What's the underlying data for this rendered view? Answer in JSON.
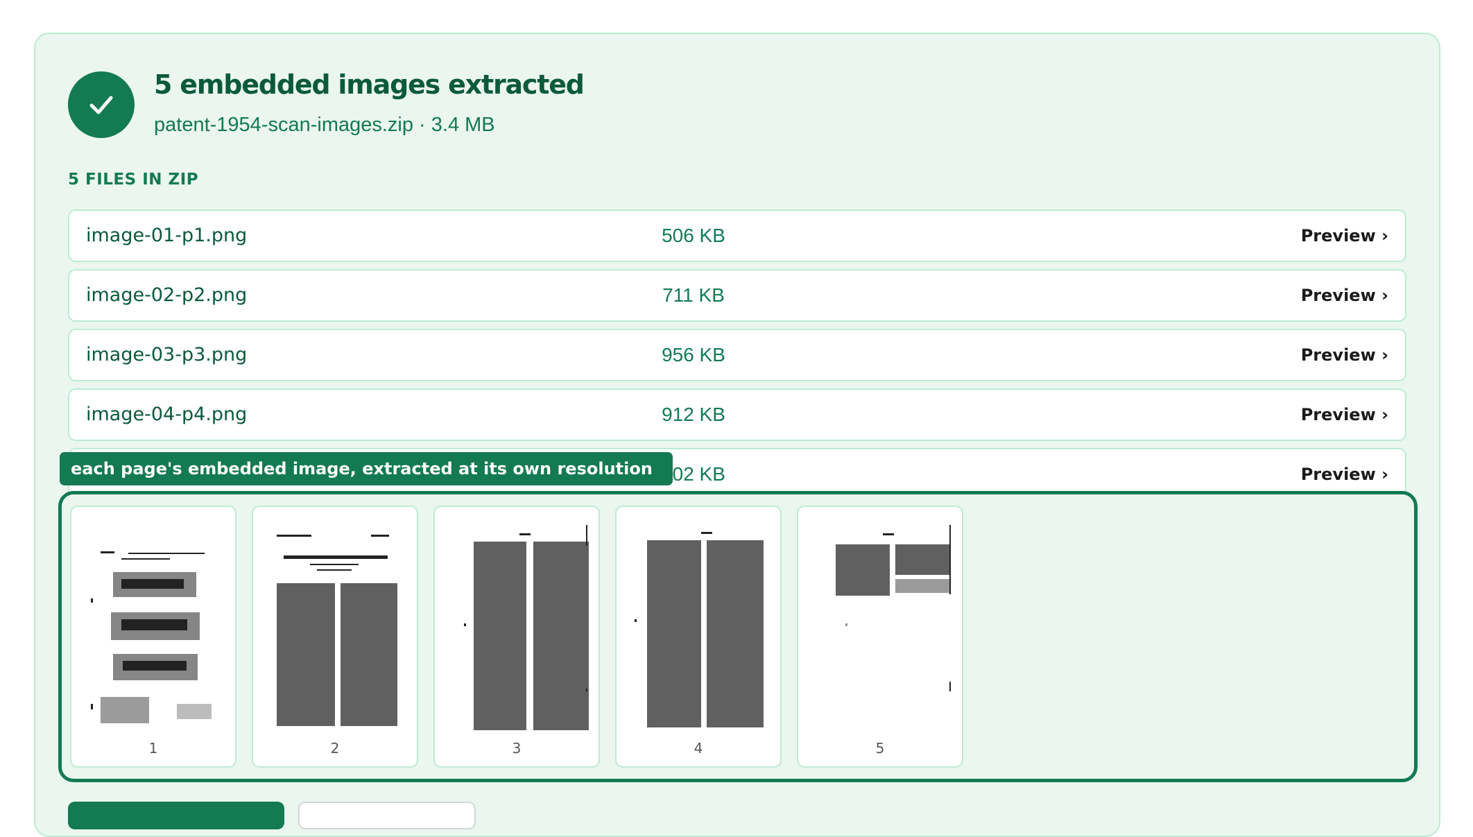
{
  "summary": {
    "title": "5 embedded images extracted",
    "subtitle": "patent-1954-scan-images.zip · 3.4 MB",
    "status_icon": "check-icon",
    "accent_color": "#137a52"
  },
  "files": {
    "label": "5 FILES IN ZIP",
    "preview_label": "Preview ›",
    "items": [
      {
        "name": "image-01-p1.png",
        "size": "506 KB"
      },
      {
        "name": "image-02-p2.png",
        "size": "711 KB"
      },
      {
        "name": "image-03-p3.png",
        "size": "956 KB"
      },
      {
        "name": "image-04-p4.png",
        "size": "912 KB"
      },
      {
        "name": "",
        "size": "402 KB"
      }
    ]
  },
  "tooltip": {
    "text": "each page's embedded image, extracted at its own resolution"
  },
  "thumbnails": {
    "pages": [
      "1",
      "2",
      "3",
      "4",
      "5"
    ]
  }
}
